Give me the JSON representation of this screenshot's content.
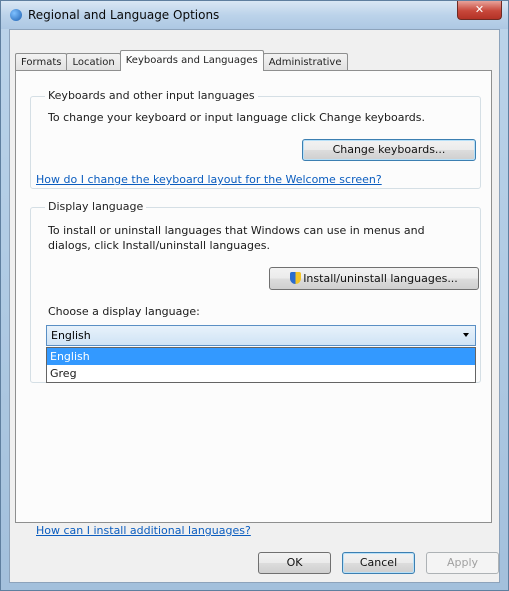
{
  "window": {
    "title": "Regional and Language Options",
    "close_glyph": "✕"
  },
  "tabs": [
    {
      "label": "Formats"
    },
    {
      "label": "Location"
    },
    {
      "label": "Keyboards and Languages",
      "active": true
    },
    {
      "label": "Administrative"
    }
  ],
  "keyboards_group": {
    "legend": "Keyboards and other input languages",
    "description": "To change your keyboard or input language click Change keyboards.",
    "button_label": "Change keyboards...",
    "welcome_link": "How do I change the keyboard layout for the Welcome screen?"
  },
  "display_group": {
    "legend": "Display language",
    "description": "To install or uninstall languages that Windows can use in menus and dialogs, click Install/uninstall languages.",
    "install_button_label": "Install/uninstall languages...",
    "choose_label": "Choose a display language:",
    "selected_value": "English",
    "options": [
      "English",
      "Greg"
    ],
    "highlighted_option": "English"
  },
  "footer": {
    "install_link": "How can I install additional languages?",
    "ok_label": "OK",
    "cancel_label": "Cancel",
    "apply_label": "Apply"
  },
  "icons": {
    "title_icon": "globe-icon",
    "install_icon": "shield-icon",
    "dropdown_icon": "chevron-down-icon"
  }
}
